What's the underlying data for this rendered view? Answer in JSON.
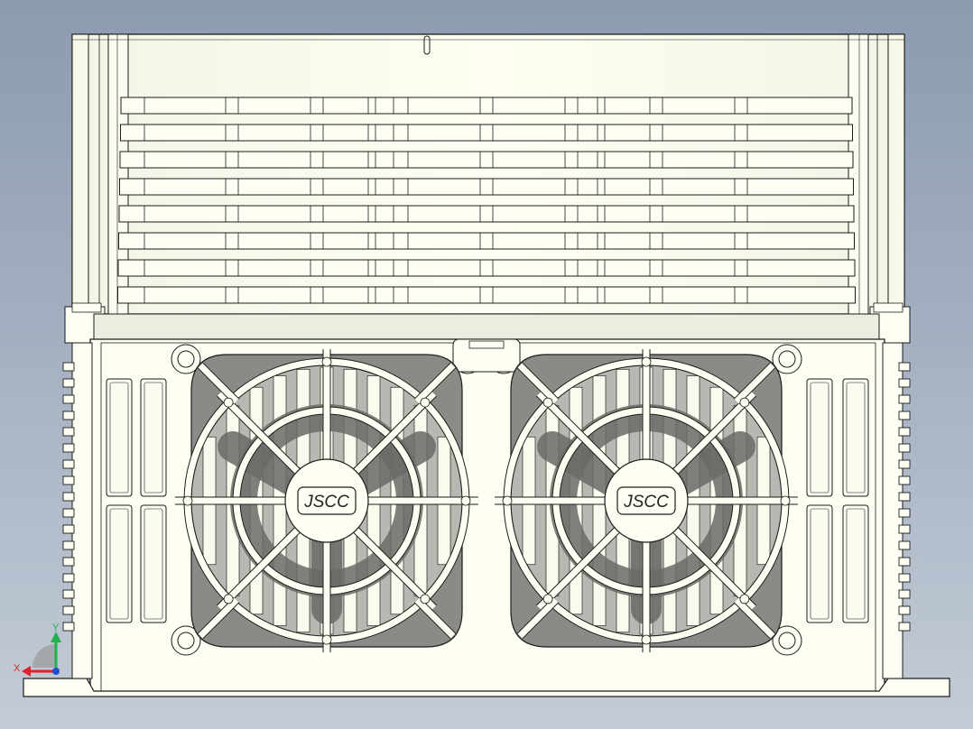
{
  "drawing": {
    "fans": [
      {
        "brand": "JSCC"
      },
      {
        "brand": "JSCC"
      }
    ],
    "triad": {
      "x_label": "X",
      "y_label": "Y",
      "x_color": "#e0202a",
      "y_color": "#22b24a",
      "z_color": "#1f4fd0"
    },
    "colors": {
      "background_top": "#8c9bb0",
      "background_bottom": "#c3cbd6",
      "housing": "#fefef2",
      "outline": "#1c1c1c",
      "fan_shroud": "#8a8a86",
      "shadow": "#4a4a48"
    }
  }
}
